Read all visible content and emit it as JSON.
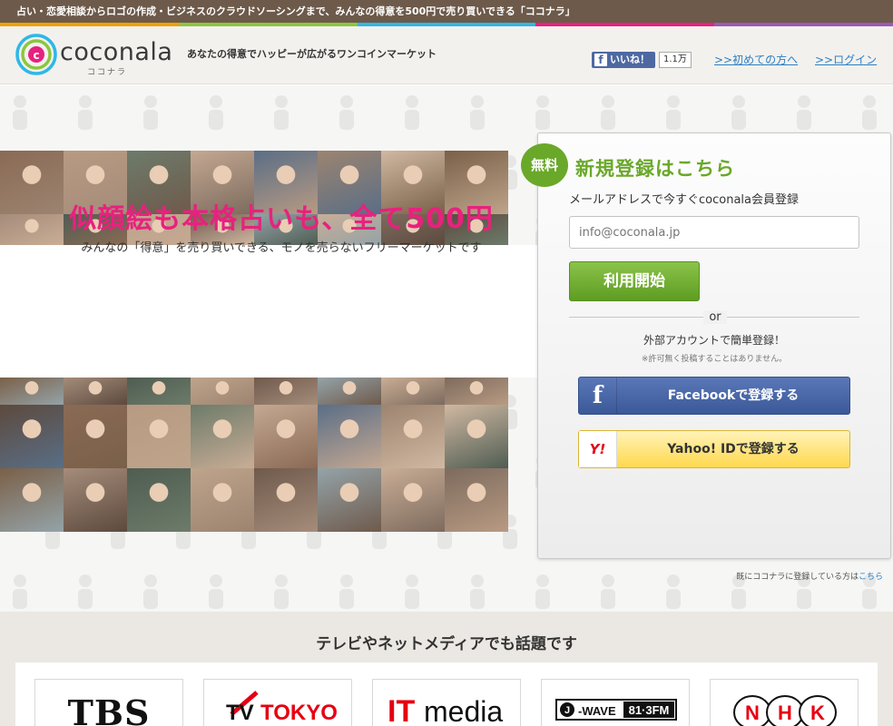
{
  "topbar": {
    "text": "占い・恋愛相談からロゴの作成・ビジネスのクラウドソーシングまで、みんなの得意を500円で売り買いできる「ココナラ」"
  },
  "stripe_colors": [
    "#f0a000",
    "#8cc63f",
    "#2eb8e6",
    "#e8217e",
    "#9b59b6"
  ],
  "header": {
    "brand": "coconala",
    "brand_sub": "ココナラ",
    "tagline": "あなたの得意でハッピーが広がるワンコインマーケット",
    "like_label": "いいね！",
    "like_count": "1.1万",
    "first_time_link": ">>初めての方へ",
    "login_link": ">>ログイン"
  },
  "hero": {
    "title": "似顔絵も本格占いも、全て500円",
    "subtitle": "みんなの「得意」を売り買いできる、モノを売らないフリーマーケットです"
  },
  "signup": {
    "badge": "無料",
    "title": "新規登録はこちら",
    "lead": "メールアドレスで今すぐcoconala会員登録",
    "email_placeholder": "info@coconala.jp",
    "start_button": "利用開始",
    "or": "or",
    "external": "外部アカウントで簡単登録！",
    "external_note": "※許可無く投稿することはありません。",
    "facebook_button": "Facebookで登録する",
    "yahoo_button": "Yahoo! IDで登録する",
    "already_text": "既にココナラに登録している方は",
    "already_link": "こちら"
  },
  "media": {
    "title": "テレビやネットメディアでも話題です",
    "logos": [
      "TBS",
      "TV TOKYO",
      "ITmedia",
      "J-WAVE 81.3FM",
      "NHK"
    ]
  },
  "colors": {
    "accent_green": "#6aa82a",
    "pink": "#e8217e",
    "link": "#2c7fc6",
    "facebook": "#3b5998"
  },
  "photo_tones": [
    "#8a6a55",
    "#b89a82",
    "#6d7b6a",
    "#c4a892",
    "#5a6e86",
    "#9c8470",
    "#d0b8a2",
    "#7a6048",
    "#a58c7a",
    "#4f5d52",
    "#bfa48c",
    "#6f5a4c",
    "#94a3a8",
    "#c9ad96",
    "#7d6b5e",
    "#5c4a3e"
  ]
}
